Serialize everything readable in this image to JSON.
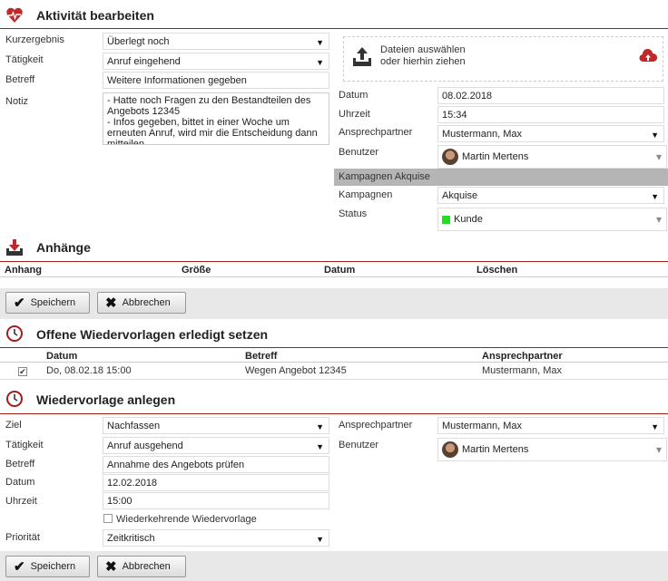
{
  "s1": {
    "title": "Aktivität bearbeiten",
    "labels": {
      "kurzergebnis": "Kurzergebnis",
      "taetigkeit": "Tätigkeit",
      "betreff": "Betreff",
      "notiz": "Notiz",
      "datum": "Datum",
      "uhrzeit": "Uhrzeit",
      "ansprechpartner": "Ansprechpartner",
      "benutzer": "Benutzer",
      "kampagnen": "Kampagnen",
      "status": "Status"
    },
    "values": {
      "kurzergebnis": "Überlegt noch",
      "taetigkeit": "Anruf eingehend",
      "betreff": "Weitere Informationen gegeben",
      "notiz": "- Hatte noch Fragen zu den Bestandteilen des Angebots 12345\n- Infos gegeben, bittet in einer Woche um erneuten Anruf, wird mir die Entscheidung dann mitteilen",
      "datum": "08.02.2018",
      "uhrzeit": "15:34",
      "ansprechpartner": "Mustermann, Max",
      "benutzer": "Martin Mertens",
      "kampagnen": "Akquise",
      "status": "Kunde"
    },
    "upload": {
      "line1": "Dateien auswählen",
      "line2": "oder hierhin ziehen"
    },
    "campaign_header": "Kampagnen Akquise"
  },
  "s2": {
    "title": "Anhänge",
    "columns": [
      "Anhang",
      "Größe",
      "Datum",
      "Löschen"
    ]
  },
  "buttons": {
    "save": "Speichern",
    "cancel": "Abbrechen"
  },
  "s3": {
    "title": "Offene Wiedervorlagen erledigt setzen",
    "columns": [
      "Datum",
      "Betreff",
      "Ansprechpartner"
    ],
    "rows": [
      {
        "datum": "Do, 08.02.18 15:00",
        "betreff": "Wegen Angebot 12345",
        "ansprechpartner": "Mustermann, Max",
        "checked": true
      }
    ]
  },
  "s4": {
    "title": "Wiedervorlage anlegen",
    "labels": {
      "ziel": "Ziel",
      "taetigkeit": "Tätigkeit",
      "betreff": "Betreff",
      "datum": "Datum",
      "uhrzeit": "Uhrzeit",
      "prioritaet": "Priorität",
      "ansprechpartner": "Ansprechpartner",
      "benutzer": "Benutzer"
    },
    "values": {
      "ziel": "Nachfassen",
      "taetigkeit": "Anruf ausgehend",
      "betreff": "Annahme des Angebots prüfen",
      "datum": "12.02.2018",
      "uhrzeit": "15:00",
      "prioritaet": "Zeitkritisch",
      "ansprechpartner": "Mustermann, Max",
      "benutzer": "Martin Mertens"
    },
    "recurring": "Wiederkehrende Wiedervorlage"
  },
  "colors": {
    "accent": "#a31d1d",
    "status_green": "#22dd22"
  }
}
